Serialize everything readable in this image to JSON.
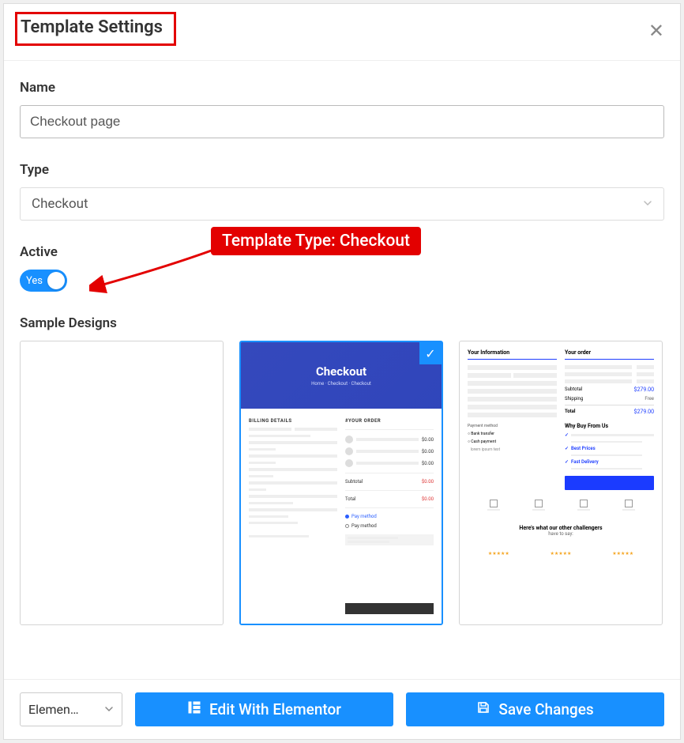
{
  "header": {
    "title": "Template Settings"
  },
  "fields": {
    "name": {
      "label": "Name",
      "value": "Checkout page"
    },
    "type": {
      "label": "Type",
      "value": "Checkout"
    },
    "active": {
      "label": "Active",
      "value": "Yes"
    },
    "sample_designs": {
      "label": "Sample Designs"
    }
  },
  "designs": {
    "card2": {
      "hero_title": "Checkout",
      "hero_sub": "Home · Checkout · Checkout",
      "billing_heading": "BILLING DETAILS",
      "order_heading": "#YOUR ORDER"
    },
    "card3": {
      "info_heading": "Your Information",
      "order_heading": "Your order",
      "why_heading": "Why Buy From Us",
      "testi_title": "Here's what our other challengers",
      "testi_sub": "have to say:"
    }
  },
  "callout": {
    "text": "Template Type: Checkout"
  },
  "footer": {
    "editor_select": "Elemen…",
    "edit_btn": "Edit With Elementor",
    "save_btn": "Save Changes"
  }
}
